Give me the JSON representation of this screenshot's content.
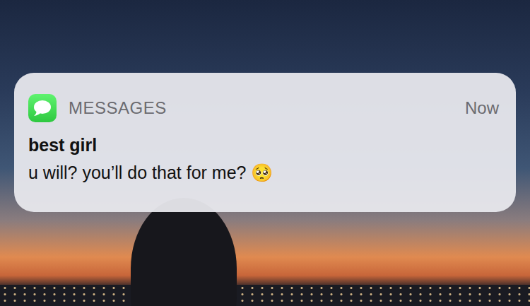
{
  "notification": {
    "app": "MESSAGES",
    "time": "Now",
    "sender": "best girl",
    "body": "u will? you’ll do that for me? 🥺"
  }
}
